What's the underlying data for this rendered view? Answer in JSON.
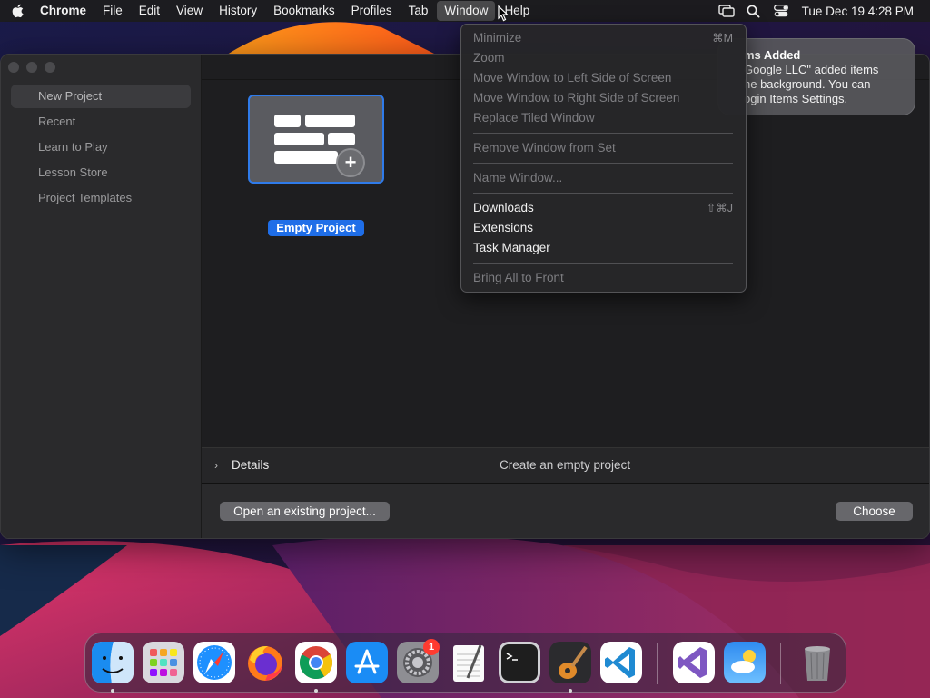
{
  "menubar": {
    "app_name": "Chrome",
    "menus": [
      "File",
      "Edit",
      "View",
      "History",
      "Bookmarks",
      "Profiles",
      "Tab",
      "Window",
      "Help"
    ],
    "active_menu": "Window",
    "clock": "Tue Dec 19  4:28 PM"
  },
  "window_menu": {
    "items": [
      {
        "label": "Minimize",
        "shortcut": "⌘M",
        "disabled": true
      },
      {
        "label": "Zoom",
        "shortcut": "",
        "disabled": true
      },
      {
        "label": "Move Window to Left Side of Screen",
        "shortcut": "",
        "disabled": true
      },
      {
        "label": "Move Window to Right Side of Screen",
        "shortcut": "",
        "disabled": true
      },
      {
        "label": "Replace Tiled Window",
        "shortcut": "",
        "disabled": true
      },
      {
        "separator": true
      },
      {
        "label": "Remove Window from Set",
        "shortcut": "",
        "disabled": true
      },
      {
        "separator": true
      },
      {
        "label": "Name Window...",
        "shortcut": "",
        "disabled": true
      },
      {
        "separator": true
      },
      {
        "label": "Downloads",
        "shortcut": "⇧⌘J",
        "disabled": false
      },
      {
        "label": "Extensions",
        "shortcut": "",
        "disabled": false
      },
      {
        "label": "Task Manager",
        "shortcut": "",
        "disabled": false
      },
      {
        "separator": true
      },
      {
        "label": "Bring All to Front",
        "shortcut": "",
        "disabled": true
      }
    ]
  },
  "notification": {
    "title": "ms Added",
    "body": "Google LLC\" added items\nhe background. You can\nogin Items Settings."
  },
  "sidebar": {
    "items": [
      {
        "label": "New Project",
        "selected": true
      },
      {
        "label": "Recent",
        "selected": false
      },
      {
        "label": "Learn to Play",
        "selected": false
      },
      {
        "label": "Lesson Store",
        "selected": false
      },
      {
        "label": "Project Templates",
        "selected": false
      }
    ]
  },
  "main": {
    "template_label": "Empty Project"
  },
  "details": {
    "label": "Details",
    "description": "Create an empty project"
  },
  "footer": {
    "open_label": "Open an existing project...",
    "choose_label": "Choose"
  },
  "dock": {
    "apps": [
      "finder-icon",
      "launchpad-icon",
      "safari-icon",
      "firefox-icon",
      "chrome-icon",
      "app-store-icon",
      "system-settings-icon",
      "textedit-icon",
      "terminal-icon",
      "garageband-icon",
      "vscode-icon",
      "visual-studio-icon",
      "weather-icon",
      "trash-icon"
    ],
    "settings_badge": "1"
  },
  "colors": {
    "accent": "#1f6ee8",
    "menubar_bg": "#1c1c1e",
    "badge": "#ff3b30"
  }
}
